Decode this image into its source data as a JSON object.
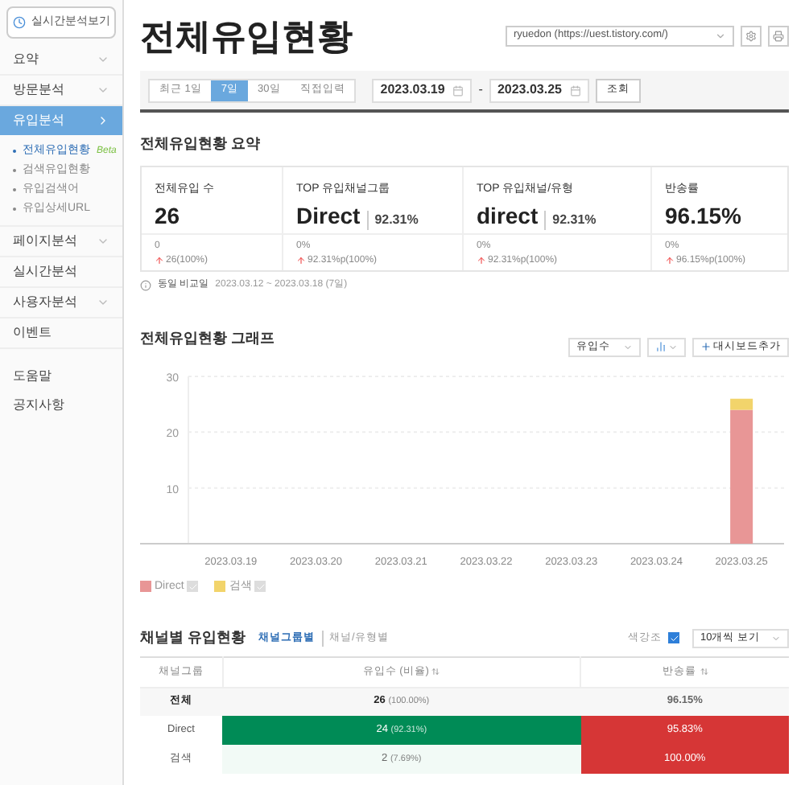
{
  "sidebar": {
    "realtime_button": "실시간분석보기",
    "items": [
      {
        "label": "요약",
        "has_submenu": true,
        "selected": false
      },
      {
        "label": "방문분석",
        "has_submenu": true,
        "selected": false
      },
      {
        "label": "유입분석",
        "has_submenu": true,
        "selected": true,
        "children": [
          {
            "label": "전체유입현황",
            "badge": "Beta",
            "selected": true
          },
          {
            "label": "검색유입현황",
            "selected": false
          },
          {
            "label": "유입검색어",
            "selected": false
          },
          {
            "label": "유입상세URL",
            "selected": false
          }
        ]
      },
      {
        "label": "페이지분석",
        "has_submenu": true,
        "selected": false
      },
      {
        "label": "실시간분석",
        "has_submenu": false,
        "selected": false
      },
      {
        "label": "사용자분석",
        "has_submenu": true,
        "selected": false
      },
      {
        "label": "이벤트",
        "has_submenu": false,
        "selected": false
      }
    ],
    "footer_items": [
      "도움말",
      "공지사항"
    ]
  },
  "page_title": "전체유입현황",
  "site_select": {
    "value": "ryuedon (https://uest.tistory.com/)"
  },
  "period_tabs": [
    {
      "label": "최근 1일",
      "selected": false
    },
    {
      "label": "7일",
      "selected": true
    },
    {
      "label": "30일",
      "selected": false
    },
    {
      "label": "직접입력",
      "selected": false
    }
  ],
  "date_from": "2023.03.19",
  "date_separator": "-",
  "date_to": "2023.03.25",
  "search_button": "조회",
  "summary": {
    "title": "전체유입현황 요약",
    "cards": [
      {
        "label": "전체유입 수",
        "value": "26",
        "change": "0",
        "delta": "26(100%)"
      },
      {
        "label": "TOP 유입채널그룹",
        "value": "Direct",
        "sub": "92.31%",
        "change": "0%",
        "delta": "92.31%p(100%)"
      },
      {
        "label": "TOP 유입채널/유형",
        "value": "direct",
        "sub": "92.31%",
        "change": "0%",
        "delta": "92.31%p(100%)"
      },
      {
        "label": "반송률",
        "value": "96.15%",
        "change": "0%",
        "delta": "96.15%p(100%)"
      }
    ],
    "comparison_label": "동일 비교일",
    "comparison_range": "2023.03.12 ~ 2023.03.18 (7일)"
  },
  "graph": {
    "title": "전체유입현황 그래프",
    "metric_select": "유입수",
    "add_dashboard": "대시보드추가",
    "chart_data": {
      "type": "bar",
      "stacked": true,
      "categories": [
        "2023.03.19",
        "2023.03.20",
        "2023.03.21",
        "2023.03.22",
        "2023.03.23",
        "2023.03.24",
        "2023.03.25"
      ],
      "series": [
        {
          "name": "Direct",
          "color": "#e89696",
          "values": [
            0,
            0,
            0,
            0,
            0,
            0,
            24
          ]
        },
        {
          "name": "검색",
          "color": "#f2d46b",
          "values": [
            0,
            0,
            0,
            0,
            0,
            0,
            2
          ]
        }
      ],
      "ylim": [
        0,
        30
      ],
      "yticks": [
        10,
        20,
        30
      ]
    },
    "legend": [
      {
        "checked": true
      },
      {
        "checked": true
      }
    ]
  },
  "channel_table": {
    "title": "채널별 유입현황",
    "views": [
      {
        "label": "채널그룹별",
        "selected": true
      },
      {
        "label": "채널/유형별",
        "selected": false
      }
    ],
    "color_emphasis": {
      "label": "색강조",
      "checked": true
    },
    "page_size": "10개씩 보기",
    "columns": [
      "채널그룹",
      "유입수 (비율)",
      "반송률"
    ],
    "rows": [
      {
        "name": "전체",
        "total": true,
        "inflow": {
          "value": "26",
          "ratio": "(100.00%)"
        },
        "bounce": {
          "value": "96.15%"
        }
      },
      {
        "name": "Direct",
        "total": false,
        "inflow": {
          "value": "24",
          "ratio": "(92.31%)",
          "color": "#008b56"
        },
        "bounce": {
          "value": "95.83%",
          "color": "#d63636"
        }
      },
      {
        "name": "검색",
        "total": false,
        "inflow": {
          "value": "2",
          "ratio": "(7.69%)",
          "color": "#f2faf6"
        },
        "bounce": {
          "value": "100.00%",
          "color": "#d63636"
        }
      }
    ]
  }
}
